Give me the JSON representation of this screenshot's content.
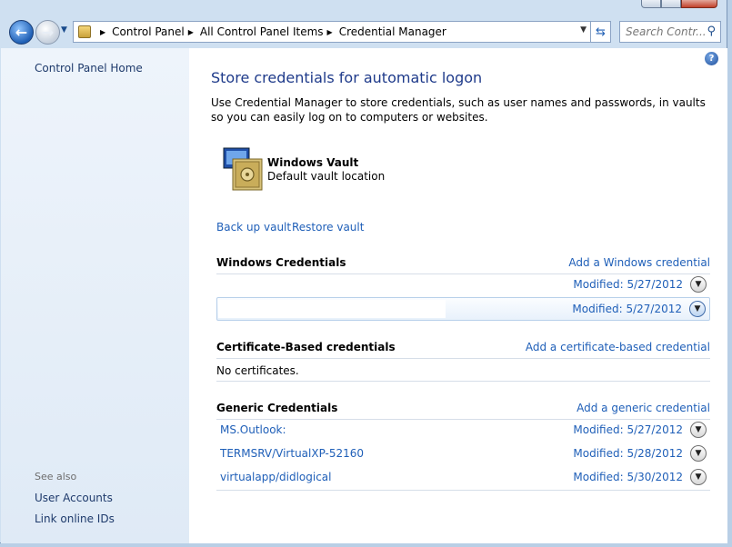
{
  "nav": {
    "breadcrumbs": [
      "Control Panel",
      "All Control Panel Items",
      "Credential Manager"
    ],
    "search_placeholder": "Search Contr..."
  },
  "sidebar": {
    "home_link": "Control Panel Home",
    "see_also_label": "See also",
    "see_also_links": [
      "User Accounts",
      "Link online IDs"
    ]
  },
  "main": {
    "title": "Store credentials for automatic logon",
    "description": "Use Credential Manager to store credentials, such as user names and passwords, in vaults so you can easily log on to computers or websites.",
    "vault": {
      "name": "Windows Vault",
      "location": "Default vault location",
      "backup_link": "Back up vault",
      "restore_link": "Restore vault"
    },
    "windows_credentials": {
      "title": "Windows Credentials",
      "add_link": "Add a Windows credential",
      "items": [
        {
          "name": "",
          "modified": "Modified:  5/27/2012"
        },
        {
          "name": "",
          "modified": "Modified:  5/27/2012",
          "selected": true
        }
      ]
    },
    "certificate_credentials": {
      "title": "Certificate-Based credentials",
      "add_link": "Add a certificate-based credential",
      "empty_text": "No certificates."
    },
    "generic_credentials": {
      "title": "Generic Credentials",
      "add_link": "Add a generic credential",
      "items": [
        {
          "name": "MS.Outlook:",
          "modified": "Modified:  5/27/2012"
        },
        {
          "name": "TERMSRV/VirtualXP-52160",
          "modified": "Modified:  5/28/2012"
        },
        {
          "name": "virtualapp/didlogical",
          "modified": "Modified:  5/30/2012"
        }
      ]
    }
  },
  "colors": {
    "link": "#1f5fb8",
    "title": "#1e3a8a",
    "sidebar_bg": "#eef4fb"
  }
}
